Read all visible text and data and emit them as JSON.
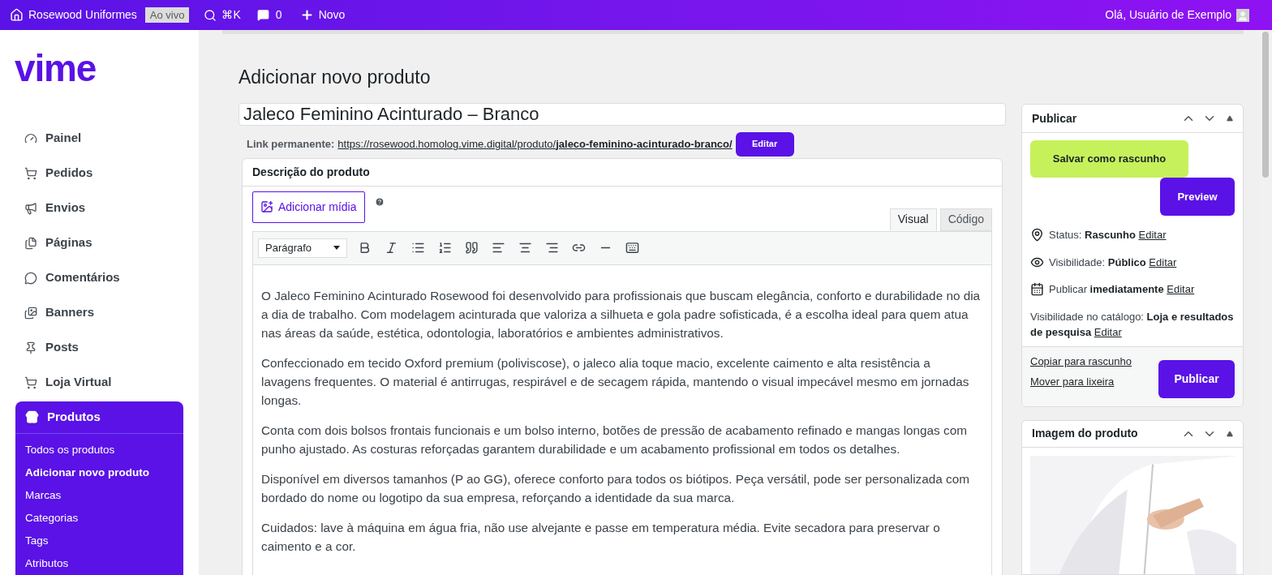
{
  "top_bar": {
    "site": "Rosewood Uniformes",
    "live_badge": "Ao vivo",
    "search_shortcut": "⌘K",
    "comments_count": "0",
    "new_label": "Novo",
    "greeting": "Olá, Usuário de Exemplo"
  },
  "sidebar": {
    "logo": "vime",
    "items": [
      {
        "label": "Painel"
      },
      {
        "label": "Pedidos"
      },
      {
        "label": "Envios"
      },
      {
        "label": "Páginas"
      },
      {
        "label": "Comentários"
      },
      {
        "label": "Banners"
      },
      {
        "label": "Posts"
      },
      {
        "label": "Loja Virtual"
      }
    ],
    "submenu": {
      "title": "Produtos",
      "items": [
        {
          "label": "Todos os produtos",
          "selected": false
        },
        {
          "label": "Adicionar novo produto",
          "selected": true
        },
        {
          "label": "Marcas",
          "selected": false
        },
        {
          "label": "Categorias",
          "selected": false
        },
        {
          "label": "Tags",
          "selected": false
        },
        {
          "label": "Atributos",
          "selected": false
        }
      ]
    }
  },
  "page_title": "Adicionar novo produto",
  "product_title": "Jaleco Feminino Acinturado – Branco",
  "permalink": {
    "label": "Link permanente:",
    "base": "https://rosewood.homolog.vime.digital/produto/",
    "slug": "jaleco-feminino-acinturado-branco/",
    "button": "Editar"
  },
  "description": {
    "title": "Descrição do produto",
    "add_media": "Adicionar mídia",
    "tabs": [
      {
        "label": "Visual",
        "selected": true
      },
      {
        "label": "Código",
        "selected": false
      }
    ],
    "format": "Parágrafo",
    "paragraphs": [
      "O Jaleco Feminino Acinturado Rosewood foi desenvolvido para profissionais que buscam elegância, conforto e durabilidade no dia a dia de trabalho. Com modelagem acinturada que valoriza a silhueta e gola padre sofisticada, é a escolha ideal para quem atua nas áreas da saúde, estética, odontologia, laboratórios e ambientes administrativos.",
      "Confeccionado em tecido Oxford premium (poliviscose), o jaleco alia toque macio, excelente caimento e alta resistência a lavagens frequentes. O material é antirrugas, respirável e de secagem rápida, mantendo o visual impecável mesmo em jornadas longas.",
      "Conta com dois bolsos frontais funcionais e um bolso interno, botões de pressão de acabamento refinado e mangas longas com punho ajustado. As costuras reforçadas garantem durabilidade e um acabamento profissional em todos os detalhes.",
      "Disponível em diversos tamanhos (P ao GG), oferece conforto para todos os biótipos. Peça versátil, pode ser personalizada com bordado do nome ou logotipo da sua empresa, reforçando a identidade da sua marca.",
      "Cuidados: lave à máquina em água fria, não use alvejante e passe em temperatura média. Evite secadora para preservar o caimento e a cor."
    ]
  },
  "publish": {
    "title": "Publicar",
    "save_draft": "Salvar como rascunho",
    "preview": "Preview",
    "rows": [
      {
        "kind": "status",
        "label": "Status:",
        "value": "Rascunho",
        "link": "Editar"
      },
      {
        "kind": "visibility",
        "label": "Visibilidade:",
        "value": "Público",
        "link": "Editar"
      },
      {
        "kind": "schedule",
        "label": "Publicar",
        "value": "imediatamente",
        "link": "Editar"
      }
    ],
    "catalog": {
      "label": "Visibilidade no catálogo:",
      "value": "Loja e resultados de pesquisa",
      "link": "Editar"
    },
    "copy_link": "Copiar para rascunho",
    "trash_link": "Mover para lixeira",
    "publish_button": "Publicar"
  },
  "image_box": {
    "title": "Imagem do produto"
  }
}
